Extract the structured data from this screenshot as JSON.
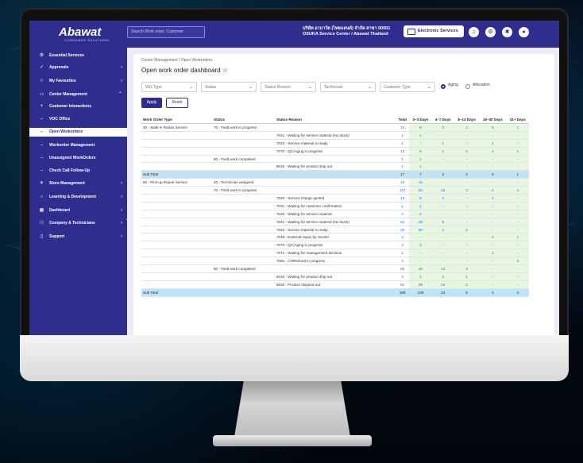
{
  "app": {
    "logo": "Abawat",
    "logo_sub": "CONSUMER SOLUTIONS"
  },
  "topbar": {
    "search_placeholder": "Search Work order, Customer",
    "company_line1": "บริษัท อาบาวัต (ไทยแลนด์) จำกัด สาขา 00001",
    "company_line2": "OSUKA Service Center / Abawat Thailand",
    "service_button": "Electronic Services",
    "icons": [
      "bell-icon",
      "gear-icon",
      "settings-icon",
      "user-icon"
    ]
  },
  "sidebar": {
    "items": [
      {
        "label": "Essential Services",
        "icon": "⚙",
        "chevron": ""
      },
      {
        "label": "Approvals",
        "icon": "✓",
        "chevron": "›"
      },
      {
        "label": "My Favourites",
        "icon": "☆",
        "chevron": "›"
      },
      {
        "label": "Center Management",
        "icon": "▭",
        "chevron": "⌃"
      },
      {
        "label": "Customer Interactions",
        "icon": "+",
        "chevron": ""
      },
      {
        "label": "VOC Office",
        "icon": "–",
        "chevron": ""
      },
      {
        "label": "Open Workorders",
        "icon": "–",
        "chevron": "",
        "active": true
      },
      {
        "label": "Workorder Management",
        "icon": "–",
        "chevron": ""
      },
      {
        "label": "Unassigned WorkOrders",
        "icon": "–",
        "chevron": ""
      },
      {
        "label": "Check Call Follow-Up",
        "icon": "–",
        "chevron": ""
      },
      {
        "label": "Store Management",
        "icon": "☀",
        "chevron": "›"
      },
      {
        "label": "Learning & Development",
        "icon": "∩",
        "chevron": "›"
      },
      {
        "label": "Dashboard",
        "icon": "▦",
        "chevron": "›"
      },
      {
        "label": "Company & Technicians",
        "icon": "⚇",
        "chevron": "›"
      },
      {
        "label": "Support",
        "icon": "▯",
        "chevron": "›"
      }
    ]
  },
  "page": {
    "breadcrumb": "Center Management / Open Workorders",
    "title": "Open work order dashboard ☆",
    "filters": [
      "WO Type",
      "Status",
      "Status Reason",
      "Technician",
      "Customer Type"
    ],
    "radio_aging": "Aging",
    "radio_allocation": "Allocation",
    "apply": "Apply",
    "reset": "Reset"
  },
  "table": {
    "headers": [
      "Work Order Type",
      "Status",
      "Status Reason",
      "Total",
      "0–3 Days",
      "4–7 Days",
      "8–14 Days",
      "15–30 Days",
      "31+ Days"
    ],
    "rows": [
      {
        "type": "30 - Walk-in Repair Service",
        "status": "70 - Field work in progress",
        "reason": "",
        "v": [
          "16",
          "6",
          "3",
          "2",
          "5",
          "1"
        ],
        "sub": false
      },
      {
        "type": "",
        "status": "",
        "reason": "7041 - Waiting for service material (No stock)",
        "v": [
          "1",
          "1",
          "-",
          "-",
          "-",
          "-"
        ],
        "sub": false
      },
      {
        "type": "",
        "status": "",
        "reason": "7043 - Service material is ready",
        "v": [
          "2",
          "-",
          "1",
          "-",
          "1",
          "-"
        ],
        "sub": false
      },
      {
        "type": "",
        "status": "",
        "reason": "7070 - QC/Aging in progress",
        "v": [
          "13",
          "5",
          "1",
          "2",
          "4",
          "1"
        ],
        "sub": false
      },
      {
        "type": "",
        "status": "80 - Field work completed",
        "reason": "",
        "v": [
          "1",
          "1",
          "-",
          "-",
          "-",
          "-"
        ],
        "sub": false
      },
      {
        "type": "",
        "status": "",
        "reason": "8010 - Waiting for product ship out",
        "v": [
          "1",
          "1",
          "-",
          "-",
          "-",
          "-"
        ],
        "sub": false
      },
      {
        "type": "Sub Total",
        "status": "",
        "reason": "",
        "v": [
          "17",
          "7",
          "2",
          "2",
          "5",
          "1"
        ],
        "sub": true
      },
      {
        "type": "50 - Pick-up Repair Service",
        "status": "40 - Technician assigned",
        "reason": "",
        "v": [
          "16",
          "16",
          "-",
          "-",
          "-",
          "-"
        ],
        "sub": false
      },
      {
        "type": "",
        "status": "70 - Field work in progress",
        "reason": "",
        "v": [
          "114",
          "92",
          "12",
          "2",
          "4",
          "4"
        ],
        "sub": false
      },
      {
        "type": "",
        "status": "",
        "reason": "7020 - Service charge quoted",
        "v": [
          "13",
          "8",
          "4",
          "-",
          "1",
          "-"
        ],
        "sub": false
      },
      {
        "type": "",
        "status": "",
        "reason": "7031 - Waiting for customer confirmation",
        "v": [
          "1",
          "1",
          "-",
          "-",
          "-",
          "-"
        ],
        "sub": false
      },
      {
        "type": "",
        "status": "",
        "reason": "7040 - Waiting for service material",
        "v": [
          "4",
          "4",
          "-",
          "-",
          "-",
          "-"
        ],
        "sub": false
      },
      {
        "type": "",
        "status": "",
        "reason": "7041 - Waiting for service material (No stock)",
        "v": [
          "54",
          "48",
          "6",
          "-",
          "-",
          "-"
        ],
        "sub": false
      },
      {
        "type": "",
        "status": "",
        "reason": "7043 - Service material is ready",
        "v": [
          "32",
          "30",
          "2",
          "2",
          "-",
          "-"
        ],
        "sub": false
      },
      {
        "type": "",
        "status": "",
        "reason": "7045 - External repair by Vendor",
        "v": [
          "3",
          "-",
          "-",
          "-",
          "2",
          "1"
        ],
        "sub": false
      },
      {
        "type": "",
        "status": "",
        "reason": "7070 - QC/Aging in progress",
        "v": [
          "3",
          "3",
          "-",
          "-",
          "-",
          "-"
        ],
        "sub": false
      },
      {
        "type": "",
        "status": "",
        "reason": "7071 - Waiting for management decision",
        "v": [
          "1",
          "-",
          "-",
          "-",
          "1",
          "-"
        ],
        "sub": false
      },
      {
        "type": "",
        "status": "",
        "reason": "7081 - CN/Refund in progress",
        "v": [
          "3",
          "-",
          "-",
          "-",
          "-",
          "3"
        ],
        "sub": false
      },
      {
        "type": "",
        "status": "80 - Field work completed",
        "reason": "",
        "v": [
          "55",
          "40",
          "12",
          "3",
          "-",
          "-"
        ],
        "sub": false
      },
      {
        "type": "",
        "status": "",
        "reason": "8010 - Waiting for product ship out",
        "v": [
          "4",
          "1",
          "2",
          "1",
          "-",
          "-"
        ],
        "sub": false
      },
      {
        "type": "",
        "status": "",
        "reason": "8020 - Product shipped out",
        "v": [
          "51",
          "39",
          "10",
          "2",
          "-",
          "-"
        ],
        "sub": false
      },
      {
        "type": "Sub Total",
        "status": "",
        "reason": "",
        "v": [
          "185",
          "148",
          "24",
          "5",
          "4",
          "4"
        ],
        "sub": true
      }
    ]
  }
}
